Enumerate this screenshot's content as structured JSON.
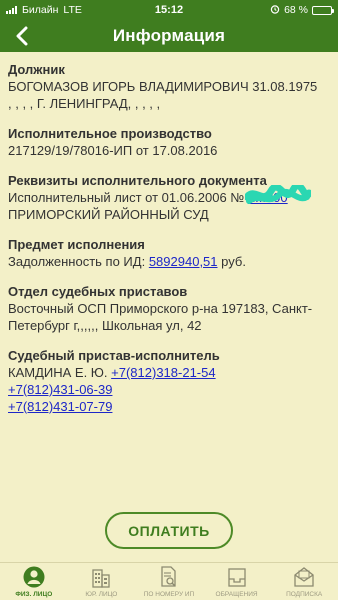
{
  "status_bar": {
    "carrier": "Билайн",
    "network": "LTE",
    "time": "15:12",
    "battery_percent": "68 %",
    "battery_level": 0.68
  },
  "nav": {
    "title": "Информация",
    "back_icon": "chevron-left-icon"
  },
  "sections": {
    "debtor": {
      "heading": "Должник",
      "line1": "БОГОМАЗОВ ИГОРЬ ВЛАДИМИРОВИЧ 31.08.1975",
      "line2": ", , , , Г. ЛЕНИНГРАД, , , , ,"
    },
    "proceeding": {
      "heading": "Исполнительное производство",
      "line1": "217129/19/78016-ИП от 17.08.2016"
    },
    "document": {
      "heading": "Реквизиты исполнительного документа",
      "line1_prefix": "Исполнительный лист от 01.06.2006 №",
      "line1_number": "1...200",
      "line2": "ПРИМОРСКИЙ РАЙОННЫЙ СУД"
    },
    "subject": {
      "heading": "Предмет исполнения",
      "prefix": "Задолженность по ИД:",
      "amount": "5892940,51",
      "suffix": "руб."
    },
    "department": {
      "heading": "Отдел судебных приставов",
      "line1": "Восточный ОСП Приморского р-на 197183, Санкт-",
      "line2": "Петербург г,,,,,, Школьная ул, 42"
    },
    "bailiff": {
      "heading": "Судебный пристав-исполнитель",
      "name": "КАМДИНА Е. Ю.",
      "phones": [
        "+7(812)318-21-54",
        "+7(812)431-06-39",
        "+7(812)431-07-79"
      ]
    }
  },
  "pay_button": "ОПЛАТИТЬ",
  "tabs": [
    {
      "label": "ФИЗ. ЛИЦО",
      "icon": "person-icon",
      "active": true
    },
    {
      "label": "ЮР. ЛИЦО",
      "icon": "building-icon",
      "active": false
    },
    {
      "label": "ПО НОМЕРУ ИП",
      "icon": "document-search-icon",
      "active": false
    },
    {
      "label": "ОБРАЩЕНИЯ",
      "icon": "inbox-icon",
      "active": false
    },
    {
      "label": "ПОДПИСКА",
      "icon": "envelope-icon",
      "active": false
    }
  ],
  "colors": {
    "brand_green": "#3f7d1f",
    "background": "#f3f0c8",
    "link": "#1d27c8",
    "redaction": "#2ad7b2"
  }
}
